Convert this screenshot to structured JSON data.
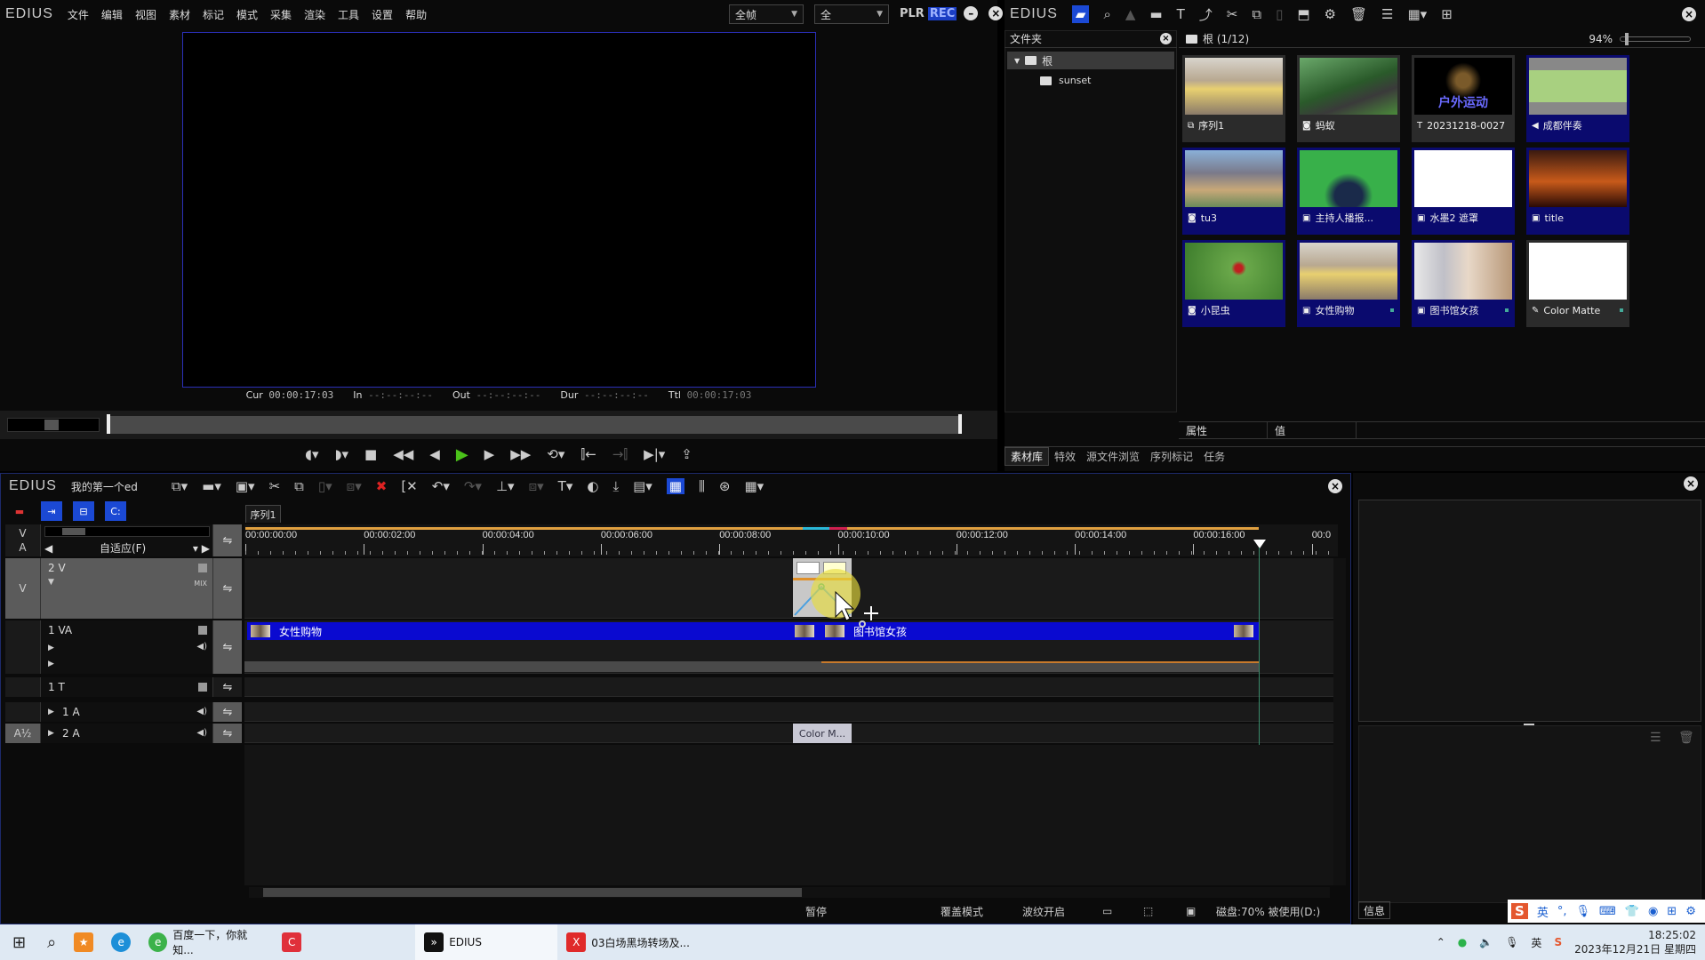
{
  "player": {
    "logo": "EDIUS",
    "menu": [
      "文件",
      "编辑",
      "视图",
      "素材",
      "标记",
      "模式",
      "采集",
      "渲染",
      "工具",
      "设置",
      "帮助"
    ],
    "frame_select": "全帧",
    "field_select": "全",
    "plr_label": "PLR",
    "rec_label": "REC",
    "timecodes": {
      "cur_label": "Cur",
      "cur": "00:00:17:03",
      "in_label": "In",
      "in": "--:--:--:--",
      "out_label": "Out",
      "out": "--:--:--:--",
      "dur_label": "Dur",
      "dur": "--:--:--:--",
      "ttl_label": "Ttl",
      "ttl": "00:00:17:03"
    },
    "transport_icons": [
      "mark-in-icon",
      "mark-out-icon",
      "stop-icon",
      "rewind-icon",
      "step-back-icon",
      "play-icon",
      "step-forward-icon",
      "fast-forward-icon",
      "loop-icon",
      "insert-icon",
      "overwrite-icon",
      "export-icon"
    ]
  },
  "bin": {
    "logo": "EDIUS",
    "folder_header": "文件夹",
    "root_folder": "根",
    "subfolder": "sunset",
    "clip_header": "根 (1/12)",
    "zoom_percent": "94%",
    "clips": [
      {
        "name": "序列1",
        "icon": "sequence-icon",
        "thumb": "shopping",
        "selected": false
      },
      {
        "name": "蚂蚁",
        "icon": "still-image-icon",
        "thumb": "ant",
        "selected": false
      },
      {
        "name": "20231218-0027",
        "icon": "title-icon",
        "thumb": "title-butterfly",
        "selected": false,
        "overlay": "户外运动"
      },
      {
        "name": "成都伴奏",
        "icon": "audio-icon",
        "thumb": "waveform",
        "selected": true
      },
      {
        "name": "tu3",
        "icon": "still-image-icon",
        "thumb": "totoro",
        "selected": true
      },
      {
        "name": "主持人播报...",
        "icon": "video-icon",
        "thumb": "greenscreen",
        "selected": true
      },
      {
        "name": "水墨2 遮罩",
        "icon": "video-icon",
        "thumb": "white",
        "selected": true
      },
      {
        "name": "title",
        "icon": "video-icon",
        "thumb": "sunset",
        "selected": true
      },
      {
        "name": "小昆虫",
        "icon": "still-image-icon",
        "thumb": "ladybug",
        "selected": true
      },
      {
        "name": "女性购物",
        "icon": "video-icon",
        "thumb": "shopping",
        "selected": true
      },
      {
        "name": "图书馆女孩",
        "icon": "video-icon",
        "thumb": "library",
        "selected": true
      },
      {
        "name": "Color Matte",
        "icon": "color-matte-icon",
        "thumb": "white",
        "selected": false
      }
    ],
    "prop_col1": "属性",
    "prop_col2": "值",
    "tabs": [
      "素材库",
      "特效",
      "源文件浏览",
      "序列标记",
      "任务"
    ],
    "active_tab": "素材库"
  },
  "timeline": {
    "logo": "EDIUS",
    "project": "我的第一个ed",
    "sequence_tab": "序列1",
    "zoom_mode": "自适应(F)",
    "ruler_labels": [
      "00:00:00:00",
      "00:00:02:00",
      "00:00:04:00",
      "00:00:06:00",
      "00:00:08:00",
      "00:00:10:00",
      "00:00:12:00",
      "00:00:14:00",
      "00:00:16:00",
      "00:0"
    ],
    "tracks": [
      {
        "id": "2V",
        "label": "2 V",
        "side": "V"
      },
      {
        "id": "1VA",
        "label": "1 VA",
        "side": ""
      },
      {
        "id": "1T",
        "label": "1 T",
        "side": ""
      },
      {
        "id": "1A",
        "label": "1 A",
        "side": ""
      },
      {
        "id": "2A",
        "label": "2 A",
        "side": "A½"
      }
    ],
    "va_label": "V",
    "a_label": "A",
    "clips": {
      "clip1": "女性购物",
      "clip2": "图书馆女孩",
      "color_matte": "Color M..."
    },
    "status": {
      "state": "暂停",
      "mode": "覆盖模式",
      "ripple": "波纹开启",
      "disk": "磁盘:70% 被使用(D:)"
    }
  },
  "info_panel": {
    "tab": "信息"
  },
  "ime": {
    "logo": "S",
    "lang": "英"
  },
  "taskbar": {
    "items": [
      {
        "label": "百度一下，你就知...",
        "icon": "browser-icon"
      },
      {
        "label": "",
        "icon": "screen-recorder-icon"
      },
      {
        "label": "EDIUS",
        "icon": "edius-icon",
        "active": true
      },
      {
        "label": "03白场黑场转场及...",
        "icon": "wps-icon"
      }
    ],
    "tray_lang": "英",
    "time": "18:25:02",
    "date": "2023年12月21日 星期四"
  }
}
